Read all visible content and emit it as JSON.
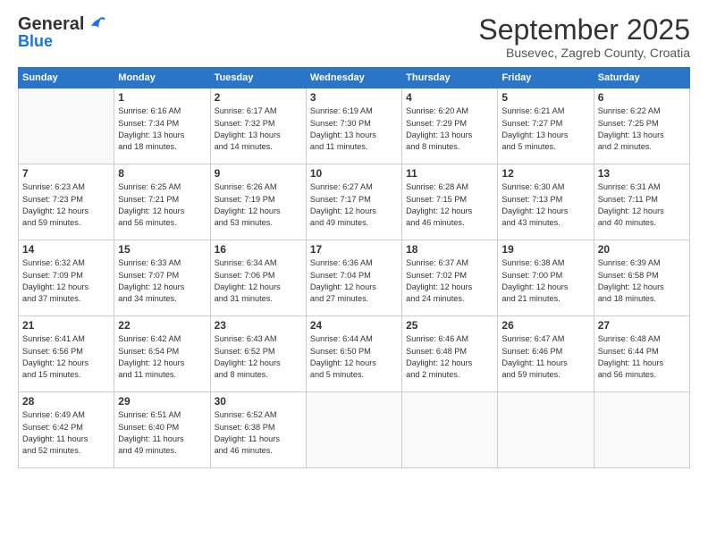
{
  "header": {
    "logo_general": "General",
    "logo_blue": "Blue",
    "month": "September 2025",
    "location": "Busevec, Zagreb County, Croatia"
  },
  "days_of_week": [
    "Sunday",
    "Monday",
    "Tuesday",
    "Wednesday",
    "Thursday",
    "Friday",
    "Saturday"
  ],
  "weeks": [
    [
      {
        "day": "",
        "info": ""
      },
      {
        "day": "1",
        "info": "Sunrise: 6:16 AM\nSunset: 7:34 PM\nDaylight: 13 hours\nand 18 minutes."
      },
      {
        "day": "2",
        "info": "Sunrise: 6:17 AM\nSunset: 7:32 PM\nDaylight: 13 hours\nand 14 minutes."
      },
      {
        "day": "3",
        "info": "Sunrise: 6:19 AM\nSunset: 7:30 PM\nDaylight: 13 hours\nand 11 minutes."
      },
      {
        "day": "4",
        "info": "Sunrise: 6:20 AM\nSunset: 7:29 PM\nDaylight: 13 hours\nand 8 minutes."
      },
      {
        "day": "5",
        "info": "Sunrise: 6:21 AM\nSunset: 7:27 PM\nDaylight: 13 hours\nand 5 minutes."
      },
      {
        "day": "6",
        "info": "Sunrise: 6:22 AM\nSunset: 7:25 PM\nDaylight: 13 hours\nand 2 minutes."
      }
    ],
    [
      {
        "day": "7",
        "info": "Sunrise: 6:23 AM\nSunset: 7:23 PM\nDaylight: 12 hours\nand 59 minutes."
      },
      {
        "day": "8",
        "info": "Sunrise: 6:25 AM\nSunset: 7:21 PM\nDaylight: 12 hours\nand 56 minutes."
      },
      {
        "day": "9",
        "info": "Sunrise: 6:26 AM\nSunset: 7:19 PM\nDaylight: 12 hours\nand 53 minutes."
      },
      {
        "day": "10",
        "info": "Sunrise: 6:27 AM\nSunset: 7:17 PM\nDaylight: 12 hours\nand 49 minutes."
      },
      {
        "day": "11",
        "info": "Sunrise: 6:28 AM\nSunset: 7:15 PM\nDaylight: 12 hours\nand 46 minutes."
      },
      {
        "day": "12",
        "info": "Sunrise: 6:30 AM\nSunset: 7:13 PM\nDaylight: 12 hours\nand 43 minutes."
      },
      {
        "day": "13",
        "info": "Sunrise: 6:31 AM\nSunset: 7:11 PM\nDaylight: 12 hours\nand 40 minutes."
      }
    ],
    [
      {
        "day": "14",
        "info": "Sunrise: 6:32 AM\nSunset: 7:09 PM\nDaylight: 12 hours\nand 37 minutes."
      },
      {
        "day": "15",
        "info": "Sunrise: 6:33 AM\nSunset: 7:07 PM\nDaylight: 12 hours\nand 34 minutes."
      },
      {
        "day": "16",
        "info": "Sunrise: 6:34 AM\nSunset: 7:06 PM\nDaylight: 12 hours\nand 31 minutes."
      },
      {
        "day": "17",
        "info": "Sunrise: 6:36 AM\nSunset: 7:04 PM\nDaylight: 12 hours\nand 27 minutes."
      },
      {
        "day": "18",
        "info": "Sunrise: 6:37 AM\nSunset: 7:02 PM\nDaylight: 12 hours\nand 24 minutes."
      },
      {
        "day": "19",
        "info": "Sunrise: 6:38 AM\nSunset: 7:00 PM\nDaylight: 12 hours\nand 21 minutes."
      },
      {
        "day": "20",
        "info": "Sunrise: 6:39 AM\nSunset: 6:58 PM\nDaylight: 12 hours\nand 18 minutes."
      }
    ],
    [
      {
        "day": "21",
        "info": "Sunrise: 6:41 AM\nSunset: 6:56 PM\nDaylight: 12 hours\nand 15 minutes."
      },
      {
        "day": "22",
        "info": "Sunrise: 6:42 AM\nSunset: 6:54 PM\nDaylight: 12 hours\nand 11 minutes."
      },
      {
        "day": "23",
        "info": "Sunrise: 6:43 AM\nSunset: 6:52 PM\nDaylight: 12 hours\nand 8 minutes."
      },
      {
        "day": "24",
        "info": "Sunrise: 6:44 AM\nSunset: 6:50 PM\nDaylight: 12 hours\nand 5 minutes."
      },
      {
        "day": "25",
        "info": "Sunrise: 6:46 AM\nSunset: 6:48 PM\nDaylight: 12 hours\nand 2 minutes."
      },
      {
        "day": "26",
        "info": "Sunrise: 6:47 AM\nSunset: 6:46 PM\nDaylight: 11 hours\nand 59 minutes."
      },
      {
        "day": "27",
        "info": "Sunrise: 6:48 AM\nSunset: 6:44 PM\nDaylight: 11 hours\nand 56 minutes."
      }
    ],
    [
      {
        "day": "28",
        "info": "Sunrise: 6:49 AM\nSunset: 6:42 PM\nDaylight: 11 hours\nand 52 minutes."
      },
      {
        "day": "29",
        "info": "Sunrise: 6:51 AM\nSunset: 6:40 PM\nDaylight: 11 hours\nand 49 minutes."
      },
      {
        "day": "30",
        "info": "Sunrise: 6:52 AM\nSunset: 6:38 PM\nDaylight: 11 hours\nand 46 minutes."
      },
      {
        "day": "",
        "info": ""
      },
      {
        "day": "",
        "info": ""
      },
      {
        "day": "",
        "info": ""
      },
      {
        "day": "",
        "info": ""
      }
    ]
  ]
}
